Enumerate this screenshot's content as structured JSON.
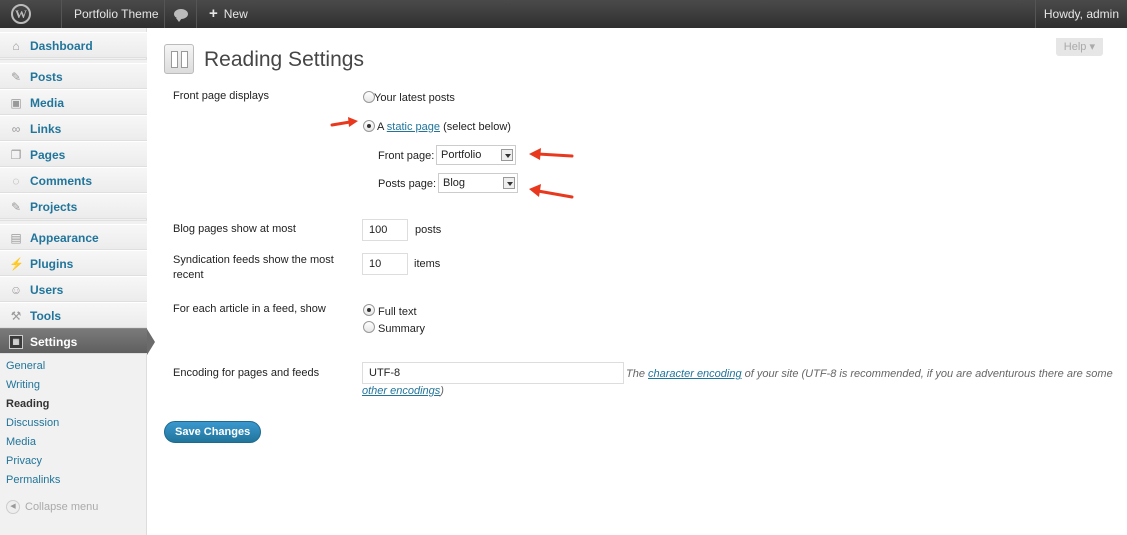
{
  "admin_bar": {
    "site_name": "Portfolio Theme",
    "new_label": "New",
    "howdy": "Howdy, admin"
  },
  "sidebar": {
    "items": [
      {
        "label": "Dashboard",
        "icon": "dashboard-icon"
      },
      {
        "label": "Posts",
        "icon": "pin-icon"
      },
      {
        "label": "Media",
        "icon": "media-icon"
      },
      {
        "label": "Links",
        "icon": "links-icon"
      },
      {
        "label": "Pages",
        "icon": "pages-icon"
      },
      {
        "label": "Comments",
        "icon": "comments-icon"
      },
      {
        "label": "Projects",
        "icon": "pin-icon"
      },
      {
        "label": "Appearance",
        "icon": "appearance-icon"
      },
      {
        "label": "Plugins",
        "icon": "plugins-icon"
      },
      {
        "label": "Users",
        "icon": "users-icon"
      },
      {
        "label": "Tools",
        "icon": "tools-icon"
      },
      {
        "label": "Settings",
        "icon": "settings-icon"
      }
    ],
    "submenu": [
      "General",
      "Writing",
      "Reading",
      "Discussion",
      "Media",
      "Privacy",
      "Permalinks"
    ],
    "collapse_label": "Collapse menu"
  },
  "help_label": "Help",
  "page_title": "Reading Settings",
  "front_page_displays": {
    "label": "Front page displays",
    "option_latest": "Your latest posts",
    "option_static_prefix": "A",
    "option_static_link": "static page",
    "option_static_suffix": "(select below)",
    "front_page_label": "Front page:",
    "front_page_value": "Portfolio",
    "posts_page_label": "Posts page:",
    "posts_page_value": "Blog"
  },
  "blog_pages": {
    "label": "Blog pages show at most",
    "value": "100",
    "suffix": "posts"
  },
  "syndication": {
    "label": "Syndication feeds show the most recent",
    "value": "10",
    "suffix": "items"
  },
  "feed_article": {
    "label": "For each article in a feed, show",
    "option_full": "Full text",
    "option_summary": "Summary"
  },
  "encoding": {
    "label": "Encoding for pages and feeds",
    "value": "UTF-8",
    "desc_prefix": "The",
    "desc_link": "character encoding",
    "desc_suffix": "of your site (UTF-8 is recommended, if you are adventurous there are some",
    "desc_link2": "other encodings",
    "desc_end": ")"
  },
  "save_label": "Save Changes",
  "colors": {
    "accent": "#21759b",
    "annotation": "#e8391f"
  }
}
